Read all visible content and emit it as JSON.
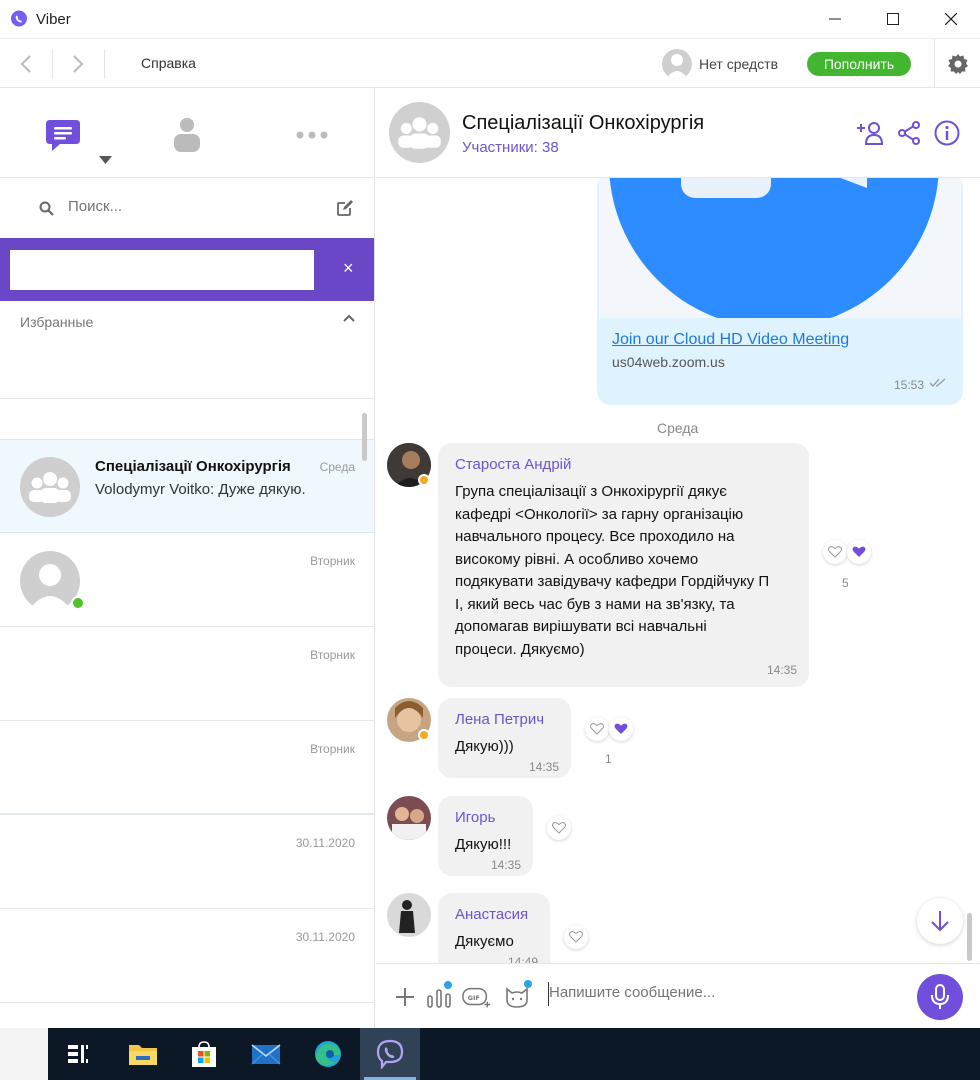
{
  "window": {
    "title": "Viber"
  },
  "nav": {
    "help": "Справка",
    "balance": "Нет средств",
    "topup": "Пополнить"
  },
  "sidebar": {
    "search_placeholder": "Поиск...",
    "banner_close": "×",
    "favorites_label": "Избранные",
    "chats": [
      {
        "name": "Спеціалізації Онкохірургія",
        "time": "Среда",
        "preview": "Volodymyr Voitko: Дуже дякую.",
        "active": true
      },
      {
        "name": "",
        "time": "Вторник",
        "preview": "",
        "online": true
      },
      {
        "name": "",
        "time": "Вторник",
        "preview": ""
      },
      {
        "name": "",
        "time": "Вторник",
        "preview": ""
      },
      {
        "name": "",
        "time": "30.11.2020",
        "preview": ""
      },
      {
        "name": "",
        "time": "30.11.2020",
        "preview": ""
      }
    ]
  },
  "chat": {
    "title": "Спеціалізації Онкохірургія",
    "members": "Участники: 38",
    "zoom": {
      "link": "Join our Cloud HD Video Meeting",
      "domain": "us04web.zoom.us",
      "time": "15:53"
    },
    "date_separator": "Среда",
    "messages": [
      {
        "sender": "Староста Андрій",
        "lines": [
          "Група спеціалізації з Онкохірургії дякує",
          "кафедрі <Онкології> за гарну організацію",
          "навчального процесу. Все проходило на",
          "високому рівні. А особливо хочемо",
          "подякувати завідувачу кафедри Гордійчуку П",
          "І, який весь час був з нами на зв'язку, та",
          "допомагав вирішувати всі навчальні",
          "процеси. Дякуємо)"
        ],
        "time": "14:35",
        "likes": "5"
      },
      {
        "sender": "Лена Петрич",
        "lines": [
          "Дякую)))"
        ],
        "time": "14:35",
        "likes": "1"
      },
      {
        "sender": "Игорь",
        "lines": [
          "Дякую!!!"
        ],
        "time": "14:35"
      },
      {
        "sender": "Анастасия",
        "lines": [
          "Дякуємо"
        ],
        "time": "14:49"
      }
    ],
    "composer_placeholder": "Напишите сообщение..."
  },
  "colors": {
    "accent": "#6f4fdc",
    "topup": "#43b62f",
    "banner": "#6a47c7",
    "own_bubble": "#dff3fe",
    "link": "#1c7ad8"
  }
}
